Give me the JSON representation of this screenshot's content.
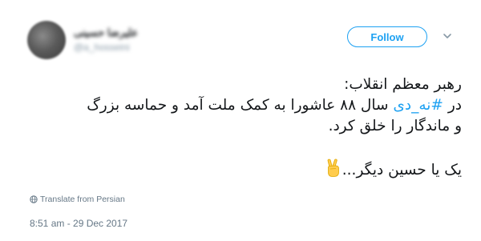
{
  "author": {
    "display_name": "علیرضا حسینی",
    "handle": "@a_hosseini"
  },
  "follow_button": {
    "label": "Follow"
  },
  "tweet": {
    "line1": "رهبر معظم انقلاب:",
    "line2_prefix": "در ",
    "hashtag": "#نه_دی",
    "line2_rest": " سال ۸۸ عاشورا به کمک ملت آمد و حماسه بزرگ",
    "line3": "و ماندگار را خلق کرد.",
    "line4": "یک یا حسین دیگر...",
    "emoji_icon": "victory-hand-icon"
  },
  "translate": {
    "label": "Translate from Persian",
    "icon": "globe-icon"
  },
  "timestamp": "8:51 am - 29 Dec 2017",
  "colors": {
    "accent": "#1da1f2",
    "text": "#14171a",
    "muted": "#657786"
  }
}
